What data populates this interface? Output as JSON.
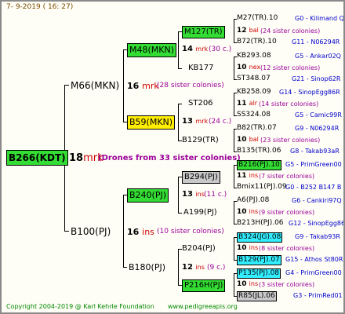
{
  "date": "7-  9-2019  ( 16:  27)",
  "colors": {
    "green": "#33dd33",
    "yellow": "#ffee00",
    "cyan": "#33eeff",
    "gray": "#c8c8c8",
    "red": "#cc0000",
    "blue": "#0000cc",
    "purple": "#990099"
  },
  "root": {
    "id": "B266(KDT)",
    "gen": "18",
    "abbr": "mrk",
    "note": "(Drones from 33 sister colonies)"
  },
  "l1": [
    {
      "id": "M66(MKN)",
      "gen": "16",
      "abbr": "mrk",
      "note": "(28 sister colonies)"
    },
    {
      "id": "B100(PJ)",
      "gen": "16",
      "abbr": "ins",
      "note": "(10 sister colonies)"
    }
  ],
  "l2": [
    {
      "id": "M48(MKN)",
      "gen": "14",
      "abbr": "mrk",
      "note": "(30 c.)"
    },
    {
      "id": "B59(MKN)",
      "gen": "13",
      "abbr": "mrk",
      "note": "(24 c.)"
    },
    {
      "id": "B240(PJ)",
      "gen": "13",
      "abbr": "ins",
      "note": "(11 c.)"
    },
    {
      "id": "B180(PJ)",
      "gen": "12",
      "abbr": "ins",
      "note": "(9 c.)"
    }
  ],
  "l3": [
    {
      "id": "M127(TR)",
      "gen": "12",
      "abbr": "bal",
      "note": "(24 sister colonies)"
    },
    {
      "id": "KB177",
      "gen": "10",
      "abbr": "nex",
      "note": "(12 sister colonies)"
    },
    {
      "id": "ST206",
      "gen": "11",
      "abbr": "alr",
      "note": "(14 sister colonies)"
    },
    {
      "id": "B129(TR)",
      "gen": "10",
      "abbr": "bal",
      "note": "(23 sister colonies)"
    },
    {
      "id": "B294(PJ)",
      "gen": "11",
      "abbr": "ins",
      "note": "(7 sister colonies)"
    },
    {
      "id": "A199(PJ)",
      "gen": "10",
      "abbr": "ins",
      "note": "(9 sister colonies)"
    },
    {
      "id": "B204(PJ)",
      "gen": "10",
      "abbr": "ins",
      "note": "(8 sister colonies)"
    },
    {
      "id": "P216H(PJ)",
      "gen": "10",
      "abbr": "ins",
      "note": "(3 sister colonies)"
    }
  ],
  "l4": [
    {
      "id": "M27(TR).10",
      "ref": "G0 - Kilimand Q"
    },
    {
      "id": "B72(TR).10",
      "ref": "G11 - N06294R"
    },
    {
      "id": "KB293.08",
      "ref": "G5 - Ankar02Q"
    },
    {
      "id": "ST348.07",
      "ref": "G21 - Sinop62R"
    },
    {
      "id": "KB258.09",
      "ref": "G14 - SinopEgg86R"
    },
    {
      "id": "SS324.08",
      "ref": "G5 - Camic99R"
    },
    {
      "id": "B82(TR).07",
      "ref": "G9 - N06294R"
    },
    {
      "id": "B135(TR).06",
      "ref": "G8 - Takab93aR"
    },
    {
      "id": "B216(PJ).10",
      "ref": "G5 - PrimGreen00"
    },
    {
      "id": "Bmix11(PJ).09",
      "ref": "G0 - B252 B147 B"
    },
    {
      "id": "A6(PJ).08",
      "ref": "G6 - Cankiri97Q"
    },
    {
      "id": "B213H(PJ).06",
      "ref": "G12 - SinopEgg86R"
    },
    {
      "id": "B324(JG).08",
      "ref": "G9 - Takab93R"
    },
    {
      "id": "B129(PJ).07",
      "ref": "G15 - Athos St80R"
    },
    {
      "id": "P135(PJ).08",
      "ref": "G4 - PrimGreen00"
    },
    {
      "id": "R85(JL).06",
      "ref": "G3 - PrimRed01"
    }
  ],
  "footer": {
    "copyright": "Copyright 2004-2019 @ Karl Kehrle Foundation",
    "url": "www.pedigreeapis.org"
  }
}
